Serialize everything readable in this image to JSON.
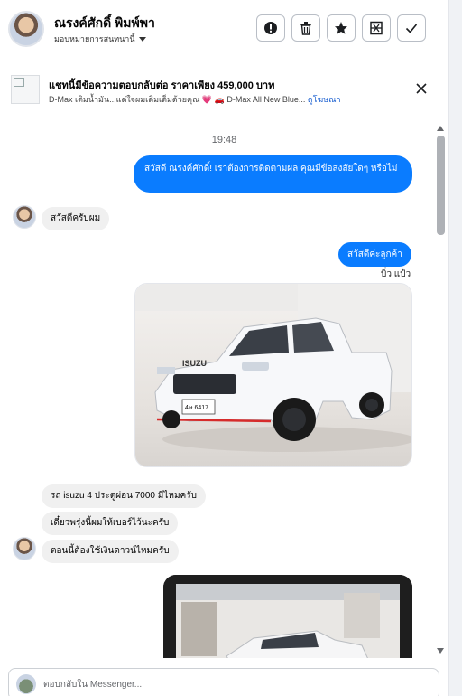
{
  "header": {
    "contact_name": "ณรงค์ศักดิ์ พิมพ์พา",
    "assign_label": "มอบหมายการสนทนานี้"
  },
  "ad": {
    "title": "แชทนี้มีข้อความตอบกลับต่อ ราคาเพียง 459,000 บาท",
    "subtitle": "D-Max เติมน้ำมัน...แต่ใจผมเติมเต็มด้วยคุณ 💗 🚗 D-Max All New Blue...",
    "link_label": "ดูโฆษณา"
  },
  "messages": {
    "timestamp": "19:48",
    "m1": "สวัสดี ณรงค์ศักดิ์! เราต้องการติดตามผล คุณมีข้อสงสัยใดๆ หรือไม่",
    "m2": "สวัสดีครับผม",
    "m3": "สวัสดีค่ะลูกค้า",
    "seen": "บิ๋ว แป๋ว",
    "m4": "รถ isuzu 4 ประตูผ่อน 7000 มีไหมครับ",
    "m5": "เดี๋ยวพรุ่งนี้ผมให้เบอร์ไว้นะครับ",
    "m6": "ตอนนี้ต้องใช้เงินดาวน์ไหมครับ",
    "photo1_plate": "4ษ 6417"
  },
  "composer": {
    "placeholder": "ตอบกลับใน Messenger..."
  },
  "colors": {
    "outgoing": "#0a7cff",
    "incoming": "#f0f0f0",
    "link": "#1a5fd0"
  }
}
